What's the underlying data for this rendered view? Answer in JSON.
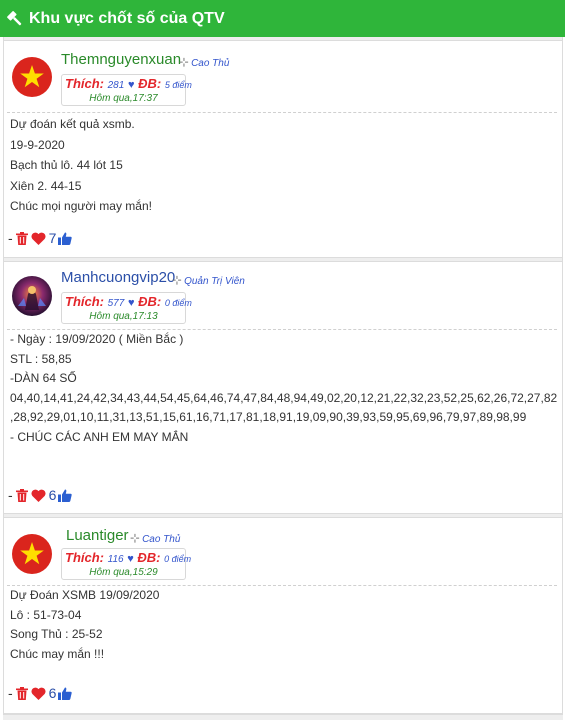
{
  "header": {
    "title": "Khu vực chốt số của QTV",
    "icon": "gavel-icon"
  },
  "colors": {
    "header_bg": "#2fb53a",
    "like_red": "#e3262b",
    "link_blue": "#2b4fa8",
    "flag_red": "#da251d",
    "flag_star": "#ffde00"
  },
  "posts": [
    {
      "username": "Themnguyenxuan",
      "role": "Cao Thủ",
      "thich_label": "Thích:",
      "thich_count": "281",
      "db_label": "ĐB:",
      "db_points": "5 điểm",
      "time": "Hôm qua,17:37",
      "lines": [
        "Dự đoán kết quả xsmb.",
        "19-9-2020",
        "Bạch thủ lô. 44 lót 15",
        "Xiên 2. 44-15",
        "Chúc mọi người may mắn!"
      ],
      "likes": "7"
    },
    {
      "username": "Manhcuongvip20",
      "role": "Quản Trị Viên",
      "thich_label": "Thích:",
      "thich_count": "577",
      "db_label": "ĐB:",
      "db_points": "0 điểm",
      "time": "Hôm qua,17:13",
      "lines": [
        "- Ngày : 19/09/2020 ( Miền Bắc )",
        "STL : 58,85",
        "-DÀN 64 SỐ",
        "04,40,14,41,24,42,34,43,44,54,45,64,46,74,47,84,48,94,49,02,20,12,21,22,32,23,52,25,62,26,72,27,82",
        ",28,92,29,01,10,11,31,13,51,15,61,16,71,17,81,18,91,19,09,90,39,93,59,95,69,96,79,97,89,98,99",
        "- CHÚC CÁC ANH EM MAY MẮN"
      ],
      "likes": "6"
    },
    {
      "username": "Luantiger",
      "role": "Cao Thủ",
      "thich_label": "Thích:",
      "thich_count": "116",
      "db_label": "ĐB:",
      "db_points": "0 điểm",
      "time": "Hôm qua,15:29",
      "lines": [
        "Dự Đoán XSMB 19/09/2020",
        "Lô : 51-73-04",
        "Song Thủ : 25-52",
        "Chúc may mắn !!!"
      ],
      "likes": "6"
    }
  ]
}
